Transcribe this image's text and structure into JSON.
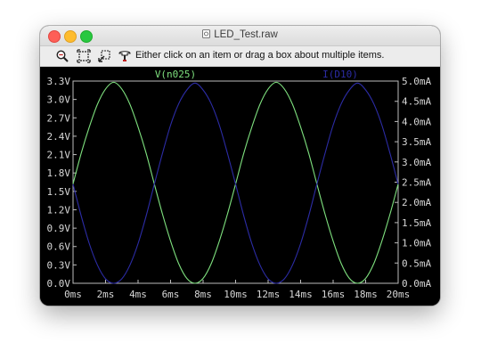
{
  "window": {
    "title": "LED_Test.raw",
    "hint": "Either click on an item or drag a box about multiple items.",
    "toolbar_icons": [
      "zoom-tool-icon",
      "autorange-icon",
      "pan-icon",
      "probe-icon"
    ]
  },
  "chart_data": {
    "type": "line",
    "xlabel": "",
    "ylabel": "",
    "y2label": "",
    "x_ticks": [
      "0ms",
      "2ms",
      "4ms",
      "6ms",
      "8ms",
      "10ms",
      "12ms",
      "14ms",
      "16ms",
      "18ms",
      "20ms"
    ],
    "y_ticks": [
      "3.3V",
      "3.0V",
      "2.7V",
      "2.4V",
      "2.1V",
      "1.8V",
      "1.5V",
      "1.2V",
      "0.9V",
      "0.6V",
      "0.3V",
      "0.0V"
    ],
    "y2_ticks": [
      "5.0mA",
      "4.5mA",
      "4.0mA",
      "3.5mA",
      "3.0mA",
      "2.5mA",
      "2.0mA",
      "1.5mA",
      "1.0mA",
      "0.5mA",
      "0.0mA"
    ],
    "xlim": [
      0,
      20
    ],
    "ylim": [
      0,
      3.3
    ],
    "y2lim": [
      0,
      5.0
    ],
    "grid": false,
    "series": [
      {
        "name": "V(n025)",
        "axis": "left",
        "color": "#7ee07e",
        "x": [
          0,
          0.5,
          1,
          1.5,
          2,
          2.5,
          3,
          3.5,
          4,
          4.5,
          5,
          5.5,
          6,
          6.5,
          7,
          7.5,
          8,
          8.5,
          9,
          9.5,
          10,
          10.5,
          11,
          11.5,
          12,
          12.5,
          13,
          13.5,
          14,
          14.5,
          15,
          15.5,
          16,
          16.5,
          17,
          17.5,
          18,
          18.5,
          19,
          19.5,
          20
        ],
        "y": [
          1.62,
          2.12,
          2.55,
          2.92,
          3.17,
          3.28,
          3.17,
          2.92,
          2.55,
          2.12,
          1.62,
          1.13,
          0.69,
          0.32,
          0.08,
          0.0,
          0.08,
          0.32,
          0.69,
          1.13,
          1.62,
          2.12,
          2.55,
          2.92,
          3.17,
          3.28,
          3.17,
          2.92,
          2.55,
          2.12,
          1.62,
          1.13,
          0.69,
          0.32,
          0.08,
          0.0,
          0.08,
          0.32,
          0.69,
          1.13,
          1.62
        ]
      },
      {
        "name": "I(D10)",
        "axis": "right",
        "color": "#2c2ca6",
        "x": [
          0,
          0.5,
          1,
          1.5,
          2,
          2.5,
          3,
          3.5,
          4,
          4.5,
          5,
          5.5,
          6,
          6.5,
          7,
          7.5,
          8,
          8.5,
          9,
          9.5,
          10,
          10.5,
          11,
          11.5,
          12,
          12.5,
          13,
          13.5,
          14,
          14.5,
          15,
          15.5,
          16,
          16.5,
          17,
          17.5,
          18,
          18.5,
          19,
          19.5,
          20
        ],
        "y": [
          2.45,
          1.67,
          0.98,
          0.45,
          0.11,
          0.0,
          0.11,
          0.45,
          0.98,
          1.67,
          2.45,
          3.21,
          3.91,
          4.44,
          4.78,
          4.95,
          4.78,
          4.44,
          3.91,
          3.21,
          2.45,
          1.67,
          0.98,
          0.45,
          0.11,
          0.0,
          0.11,
          0.45,
          0.98,
          1.67,
          2.45,
          3.21,
          3.91,
          4.44,
          4.78,
          4.95,
          4.78,
          4.44,
          3.91,
          3.21,
          2.45
        ]
      }
    ]
  }
}
